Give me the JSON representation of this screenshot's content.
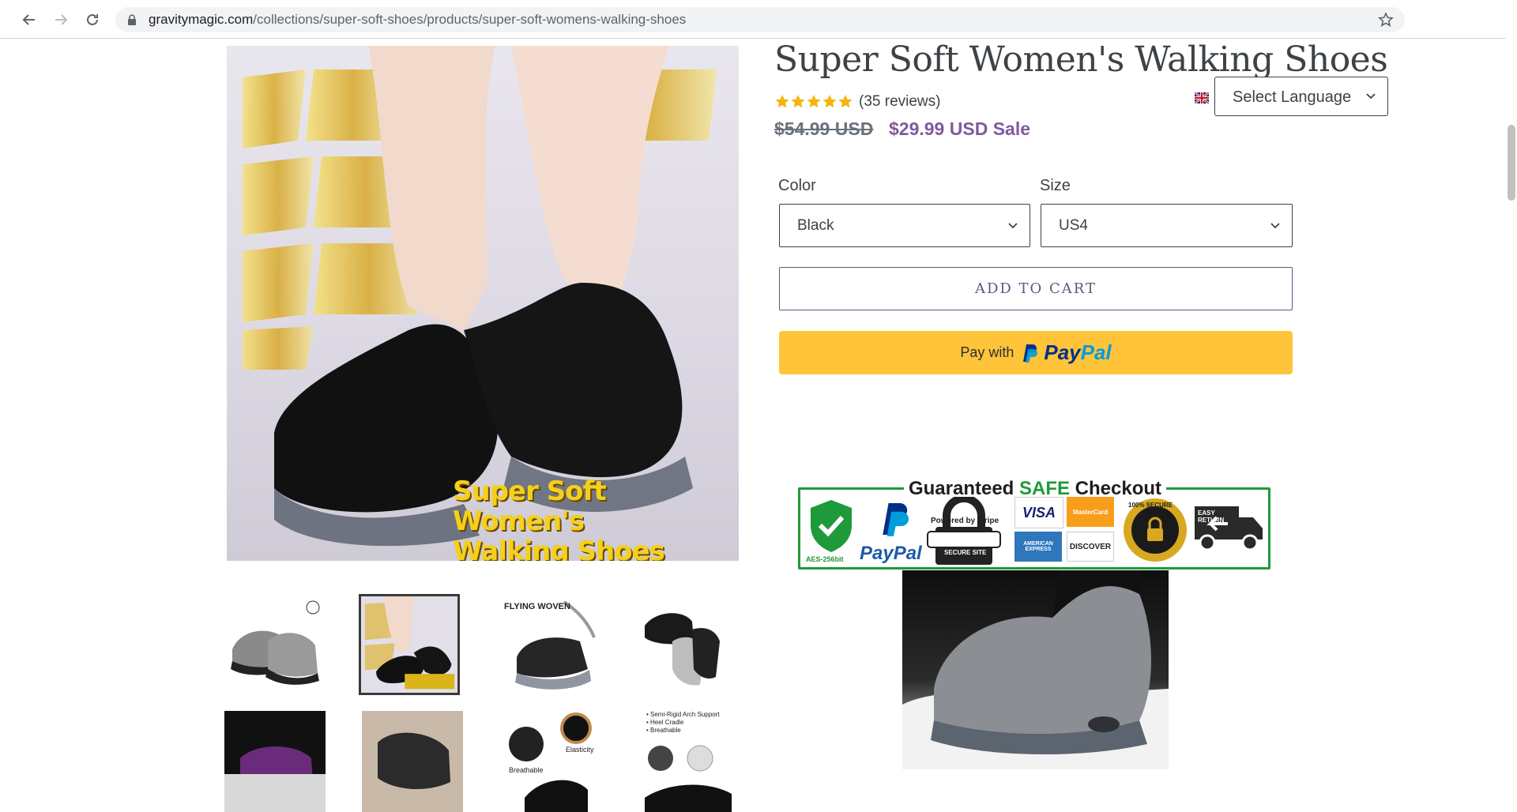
{
  "browser": {
    "url_domain": "gravitymagic.com",
    "url_path": "/collections/super-soft-shoes/products/super-soft-womens-walking-shoes"
  },
  "product": {
    "title": "Super Soft Women's Walking Shoes",
    "rating_stars": 5,
    "reviews_text": "(35 reviews)",
    "price_old": "$54.99 USD",
    "price_new": "$29.99 USD Sale",
    "main_image_caption_line1": "Super Soft Women's",
    "main_image_caption_line2": "Walking Shoes"
  },
  "language": {
    "label": "Select Language"
  },
  "options": {
    "color_label": "Color",
    "color_value": "Black",
    "size_label": "Size",
    "size_value": "US4"
  },
  "actions": {
    "add_to_cart": "ADD TO CART",
    "paypal_prefix": "Pay with",
    "paypal_brand_1": "Pay",
    "paypal_brand_2": "Pal"
  },
  "badge": {
    "title_1": "Guaranteed ",
    "title_2": "SAFE",
    "title_3": " Checkout",
    "aes": "AES-256bit",
    "paypal": "PayPal",
    "stripe": "Powered by stripe",
    "secure_site": "SECURE SITE",
    "visa": "VISA",
    "mastercard": "MasterCard",
    "amex": "AMERICAN EXPRESS",
    "discover": "DISCOVER",
    "secure_seal": "100% SECURE",
    "easy_return": "EASY RETURN"
  },
  "thumbnails": {
    "t3_text": "FLYING WOVEN",
    "t8_lines": [
      "• Semi-Rigid Arch Support",
      "• Heel Cradle",
      "• Breathable"
    ],
    "t7_labels": [
      "Elasticity",
      "Breathable"
    ]
  },
  "colors": {
    "sale": "#7e5a9e",
    "paypal_yellow": "#ffc439",
    "safe_green": "#1f9a3a",
    "title": "#3d4246"
  }
}
